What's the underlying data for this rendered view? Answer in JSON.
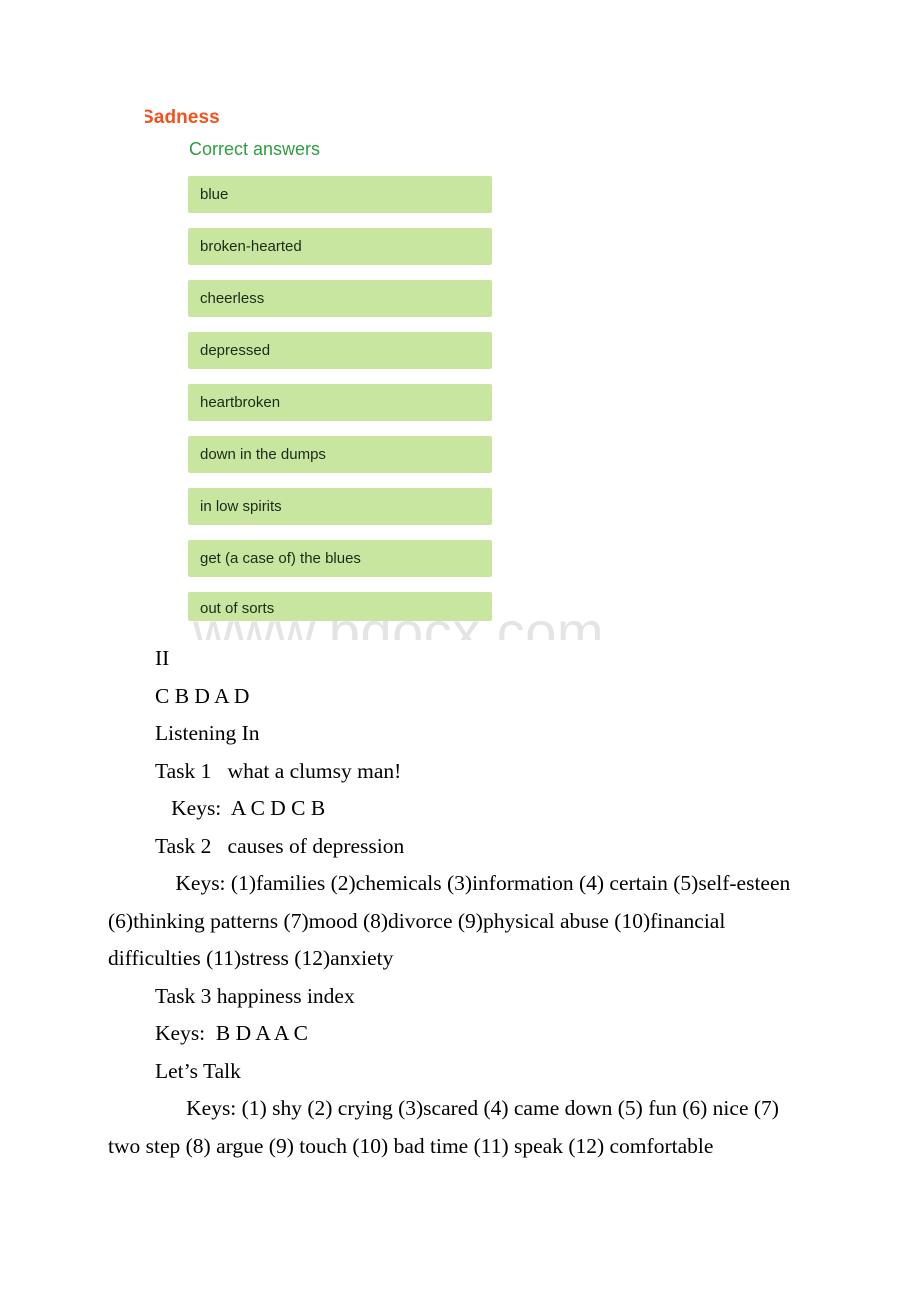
{
  "figure": {
    "title": "Sadness",
    "subtitle": "Correct answers",
    "title_color": "#f4511e",
    "subtitle_color": "#2e9e40",
    "answer_box_color": "#c9e6a1",
    "answers": [
      "blue",
      "broken-hearted",
      "cheerless",
      "depressed",
      "heartbroken",
      "down in the dumps",
      "in low spirits",
      "get (a case of) the blues",
      "out of sorts"
    ]
  },
  "watermark": {
    "text": "www.bdocx.com",
    "color": "#e4e4e4"
  },
  "document": {
    "paragraphs": [
      "II",
      "C B D A D",
      "Listening In",
      "Task 1   what a clumsy man!",
      "   Keys:  A C D C B",
      "Task 2   causes of depression",
      " Keys: (1)families (2)chemicals (3)information (4) certain (5)self-esteen (6)thinking patterns (7)mood (8)divorce (9)physical abuse (10)financial difficulties (11)stress (12)anxiety",
      "Task 3 happiness index",
      "Keys:  B D A A C",
      "Let’s Talk",
      "   Keys: (1) shy (2) crying (3)scared (4) came down (5) fun (6) nice (7) two step (8) argue (9) touch (10) bad time (11) speak (12) comfortable"
    ]
  }
}
